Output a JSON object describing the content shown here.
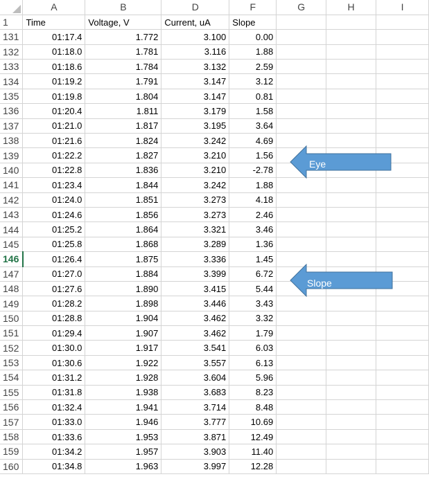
{
  "columns": [
    "A",
    "B",
    "D",
    "F",
    "G",
    "H",
    "I"
  ],
  "header_row": {
    "row": "1",
    "cells": [
      "Time",
      "Voltage, V",
      "Current, uA",
      "Slope",
      "",
      "",
      ""
    ]
  },
  "active_row": "146",
  "rows": [
    {
      "row": "131",
      "cells": [
        "01:17.4",
        "1.772",
        "3.100",
        "0.00"
      ]
    },
    {
      "row": "132",
      "cells": [
        "01:18.0",
        "1.781",
        "3.116",
        "1.88"
      ]
    },
    {
      "row": "133",
      "cells": [
        "01:18.6",
        "1.784",
        "3.132",
        "2.59"
      ]
    },
    {
      "row": "134",
      "cells": [
        "01:19.2",
        "1.791",
        "3.147",
        "3.12"
      ]
    },
    {
      "row": "135",
      "cells": [
        "01:19.8",
        "1.804",
        "3.147",
        "0.81"
      ]
    },
    {
      "row": "136",
      "cells": [
        "01:20.4",
        "1.811",
        "3.179",
        "1.58"
      ]
    },
    {
      "row": "137",
      "cells": [
        "01:21.0",
        "1.817",
        "3.195",
        "3.64"
      ]
    },
    {
      "row": "138",
      "cells": [
        "01:21.6",
        "1.824",
        "3.242",
        "4.69"
      ]
    },
    {
      "row": "139",
      "cells": [
        "01:22.2",
        "1.827",
        "3.210",
        "1.56"
      ]
    },
    {
      "row": "140",
      "cells": [
        "01:22.8",
        "1.836",
        "3.210",
        "-2.78"
      ]
    },
    {
      "row": "141",
      "cells": [
        "01:23.4",
        "1.844",
        "3.242",
        "1.88"
      ]
    },
    {
      "row": "142",
      "cells": [
        "01:24.0",
        "1.851",
        "3.273",
        "4.18"
      ]
    },
    {
      "row": "143",
      "cells": [
        "01:24.6",
        "1.856",
        "3.273",
        "2.46"
      ]
    },
    {
      "row": "144",
      "cells": [
        "01:25.2",
        "1.864",
        "3.321",
        "3.46"
      ]
    },
    {
      "row": "145",
      "cells": [
        "01:25.8",
        "1.868",
        "3.289",
        "1.36"
      ]
    },
    {
      "row": "146",
      "cells": [
        "01:26.4",
        "1.875",
        "3.336",
        "1.45"
      ]
    },
    {
      "row": "147",
      "cells": [
        "01:27.0",
        "1.884",
        "3.399",
        "6.72"
      ]
    },
    {
      "row": "148",
      "cells": [
        "01:27.6",
        "1.890",
        "3.415",
        "5.44"
      ]
    },
    {
      "row": "149",
      "cells": [
        "01:28.2",
        "1.898",
        "3.446",
        "3.43"
      ]
    },
    {
      "row": "150",
      "cells": [
        "01:28.8",
        "1.904",
        "3.462",
        "3.32"
      ]
    },
    {
      "row": "151",
      "cells": [
        "01:29.4",
        "1.907",
        "3.462",
        "1.79"
      ]
    },
    {
      "row": "152",
      "cells": [
        "01:30.0",
        "1.917",
        "3.541",
        "6.03"
      ]
    },
    {
      "row": "153",
      "cells": [
        "01:30.6",
        "1.922",
        "3.557",
        "6.13"
      ]
    },
    {
      "row": "154",
      "cells": [
        "01:31.2",
        "1.928",
        "3.604",
        "5.96"
      ]
    },
    {
      "row": "155",
      "cells": [
        "01:31.8",
        "1.938",
        "3.683",
        "8.23"
      ]
    },
    {
      "row": "156",
      "cells": [
        "01:32.4",
        "1.941",
        "3.714",
        "8.48"
      ]
    },
    {
      "row": "157",
      "cells": [
        "01:33.0",
        "1.946",
        "3.777",
        "10.69"
      ]
    },
    {
      "row": "158",
      "cells": [
        "01:33.6",
        "1.953",
        "3.871",
        "12.49"
      ]
    },
    {
      "row": "159",
      "cells": [
        "01:34.2",
        "1.957",
        "3.903",
        "11.40"
      ]
    },
    {
      "row": "160",
      "cells": [
        "01:34.8",
        "1.963",
        "3.997",
        "12.28"
      ]
    }
  ],
  "annotations": [
    {
      "name": "eye-arrow",
      "label": "Eye",
      "points_to_row": "139"
    },
    {
      "name": "slope-arrow",
      "label": "Slope",
      "points_to_row": "147"
    }
  ],
  "colors": {
    "arrow_fill": "#5b9bd5",
    "arrow_stroke": "#41719c",
    "active_row_header": "#217346",
    "gridline": "#d4d4d4"
  }
}
